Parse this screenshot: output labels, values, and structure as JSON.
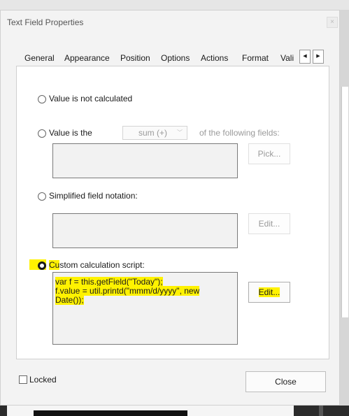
{
  "dialog": {
    "title": "Text Field Properties",
    "close_glyph": "×"
  },
  "tabs": [
    {
      "label": "General"
    },
    {
      "label": "Appearance"
    },
    {
      "label": "Position"
    },
    {
      "label": "Options"
    },
    {
      "label": "Actions"
    },
    {
      "label": "Format"
    },
    {
      "label": "Vali"
    }
  ],
  "tab_nav": {
    "prev": "◀",
    "next": "▶"
  },
  "options": {
    "not_calculated": {
      "label": "Value is not calculated",
      "selected": false
    },
    "value_is_the": {
      "label": "Value is the",
      "selected": false,
      "select_value": "sum (+)",
      "suffix": "of the following fields:",
      "pick_label": "Pick..."
    },
    "simplified": {
      "label": "Simplified field notation:",
      "selected": false,
      "edit_label": "Edit..."
    },
    "custom": {
      "label_prefix": "Cu",
      "label_rest": "stom calculation script:",
      "selected": true,
      "edit_label": "Edit...",
      "script_lines": [
        "var f = this.getField(\"Today\");",
        "f.value = util.printd(\"mmm/d/yyyy\", new",
        "Date());"
      ]
    }
  },
  "footer": {
    "locked_label": "Locked",
    "locked_checked": false,
    "close_label": "Close"
  },
  "colors": {
    "highlight": "#fff200",
    "disabled_text": "#9a9a9a"
  }
}
